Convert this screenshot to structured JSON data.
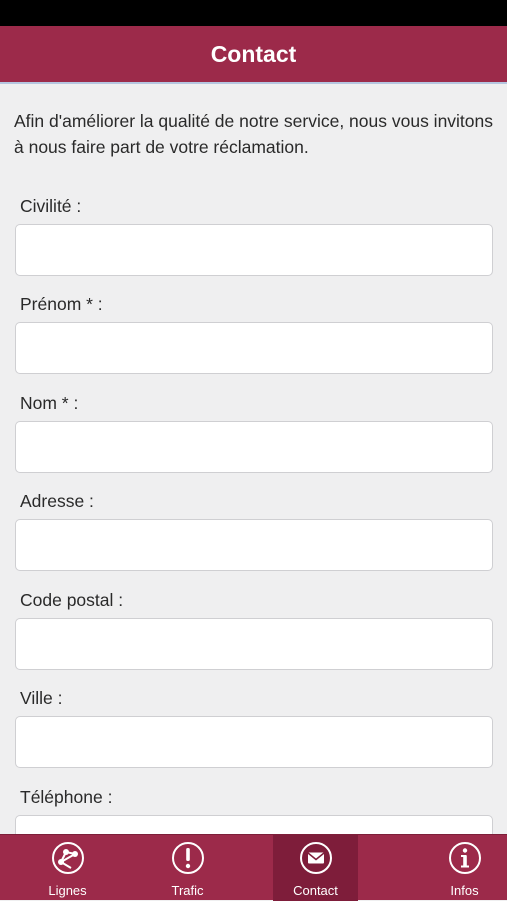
{
  "header": {
    "title": "Contact"
  },
  "intro": "Afin d'améliorer la qualité de notre service, nous vous invitons à nous faire part de votre réclamation.",
  "form": {
    "fields": [
      {
        "label": "Civilité :",
        "value": ""
      },
      {
        "label": "Prénom * :",
        "value": ""
      },
      {
        "label": "Nom * :",
        "value": ""
      },
      {
        "label": "Adresse :",
        "value": ""
      },
      {
        "label": "Code postal :",
        "value": ""
      },
      {
        "label": "Ville :",
        "value": ""
      },
      {
        "label": "Téléphone :",
        "value": ""
      }
    ]
  },
  "tabs": [
    {
      "label": "Lignes",
      "icon": "network-icon"
    },
    {
      "label": "Trafic",
      "icon": "alert-icon"
    },
    {
      "label": "Contact",
      "icon": "mail-icon",
      "active": true
    },
    {
      "label": "Infos",
      "icon": "info-icon"
    }
  ],
  "colors": {
    "primary": "#9c2a4a",
    "primary_dark": "#7e1d3a",
    "background": "#efeff0"
  }
}
